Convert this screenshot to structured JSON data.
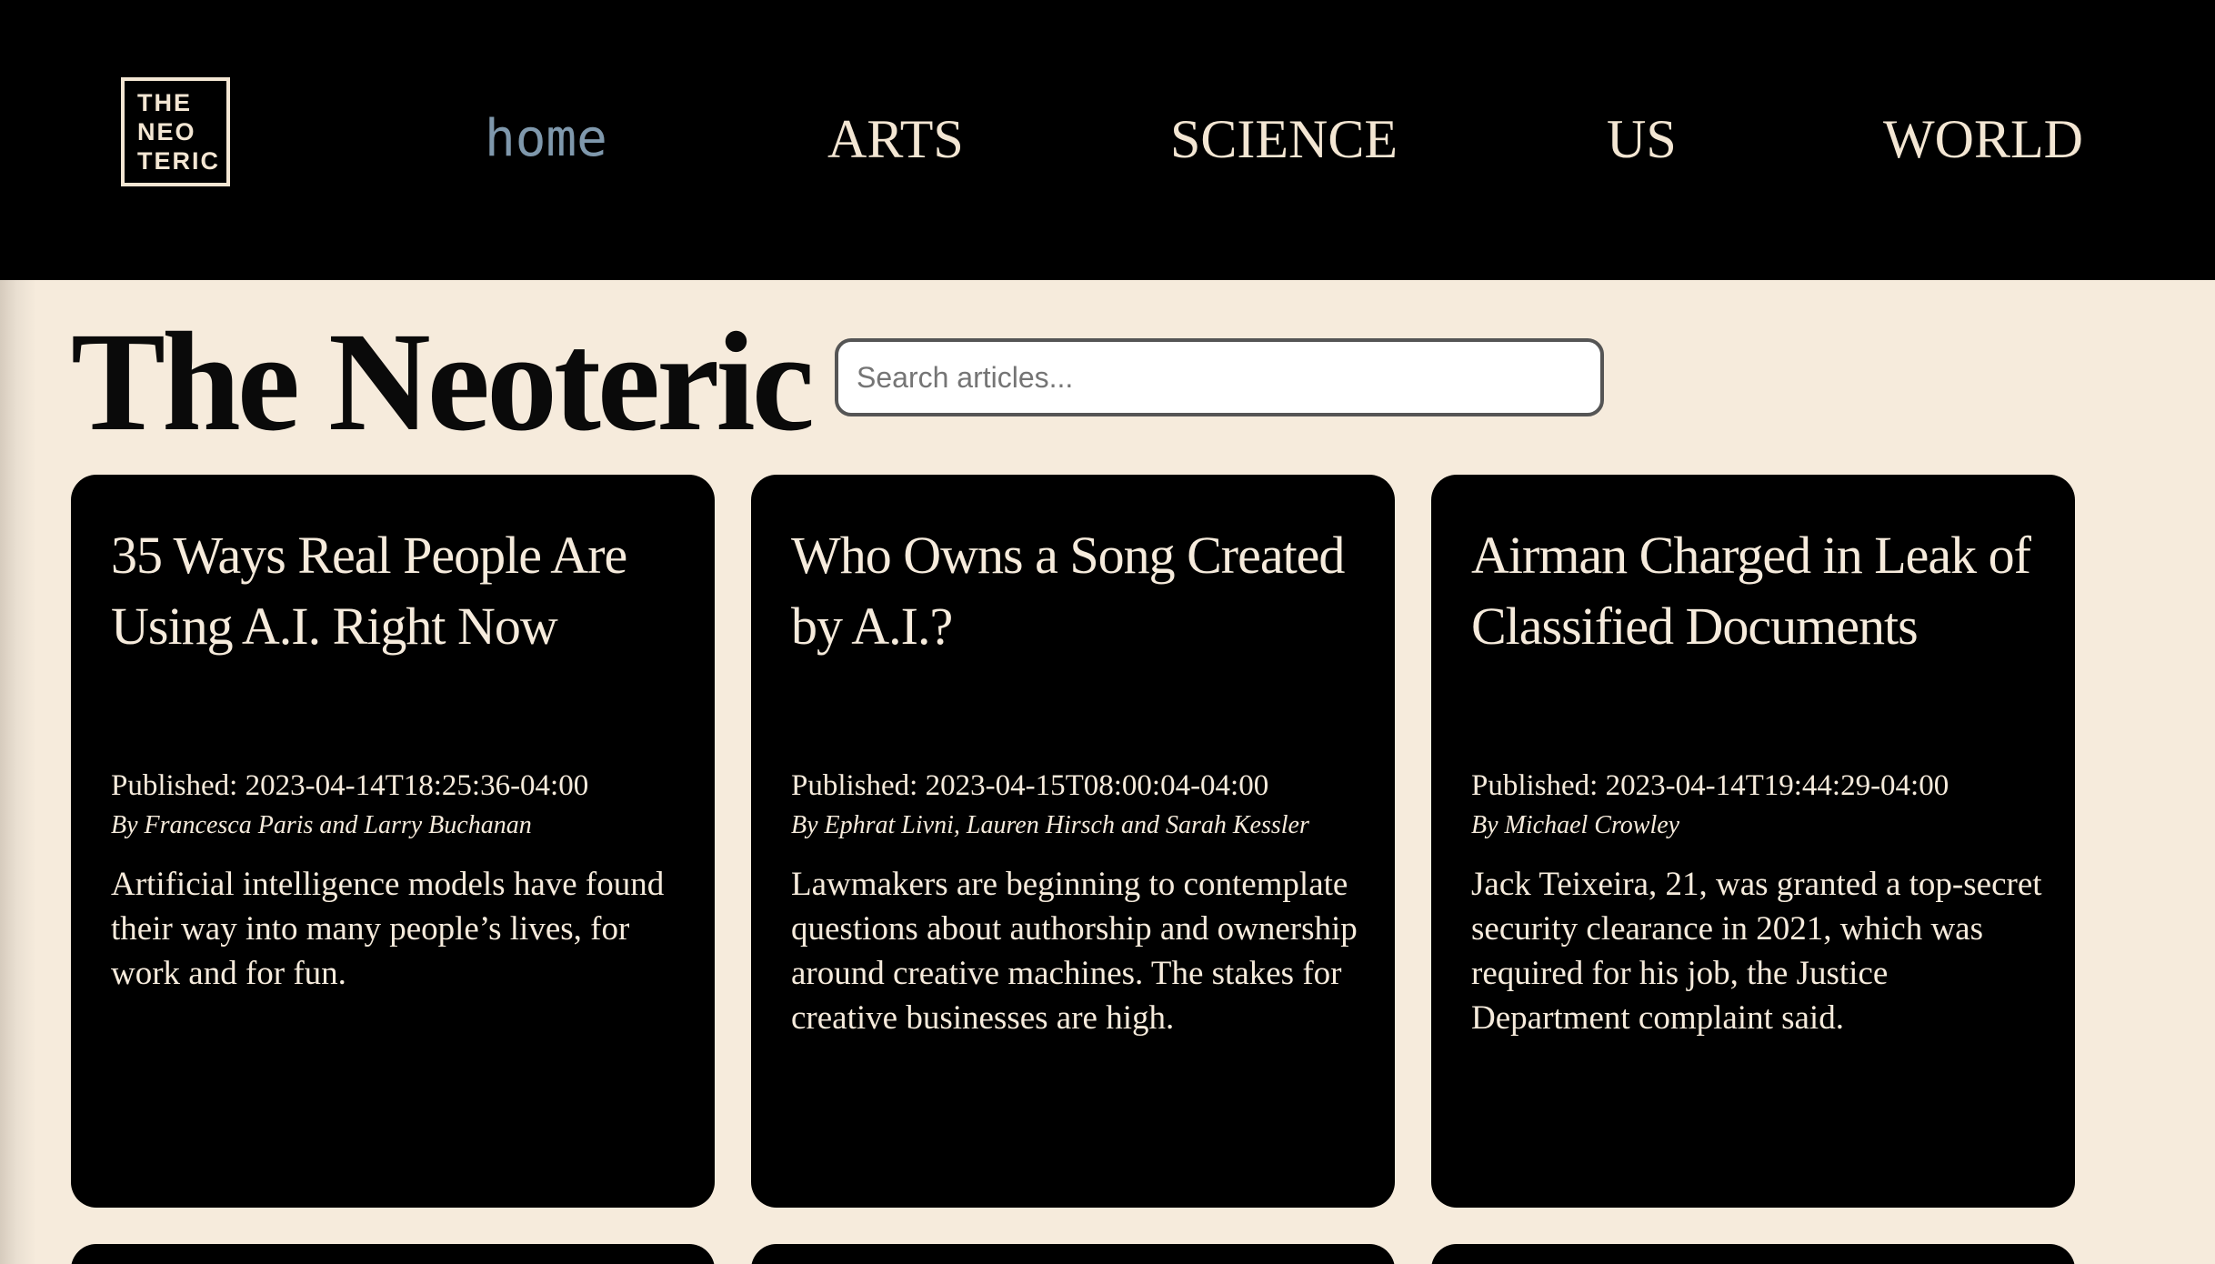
{
  "logo": {
    "lines": [
      "THE",
      "NEO",
      "TERIC"
    ]
  },
  "nav": {
    "items": [
      {
        "label": "home"
      },
      {
        "label": "ARTS"
      },
      {
        "label": "SCIENCE"
      },
      {
        "label": "US"
      },
      {
        "label": "WORLD"
      }
    ]
  },
  "main": {
    "title": "The Neoteric",
    "search": {
      "placeholder": "Search articles...",
      "value": ""
    }
  },
  "articles": [
    {
      "headline": "35 Ways Real People Are Using A.I. Right Now",
      "published": "Published: 2023-04-14T18:25:36-04:00",
      "byline": "By Francesca Paris and Larry Buchanan",
      "summary": "Artificial intelligence models have found their way into many people’s lives, for work and for fun."
    },
    {
      "headline": "Who Owns a Song Created by A.I.?",
      "published": "Published: 2023-04-15T08:00:04-04:00",
      "byline": "By Ephrat Livni, Lauren Hirsch and Sarah Kessler",
      "summary": "Lawmakers are beginning to contemplate questions about authorship and ownership around creative machines. The stakes for creative businesses are high."
    },
    {
      "headline": "Airman Charged in Leak of Classified Documents",
      "published": "Published: 2023-04-14T19:44:29-04:00",
      "byline": "By Michael Crowley",
      "summary": "Jack Teixeira, 21, was granted a top-secret security clearance in 2021, which was required for his job, the Justice Department complaint said."
    }
  ],
  "colors": {
    "header_bg": "#000000",
    "page_bg": "#f6ebdc",
    "card_bg": "#000000",
    "card_text": "#f6ebdc",
    "nav_text": "#f3e6d3",
    "nav_active": "#7f98ac"
  }
}
